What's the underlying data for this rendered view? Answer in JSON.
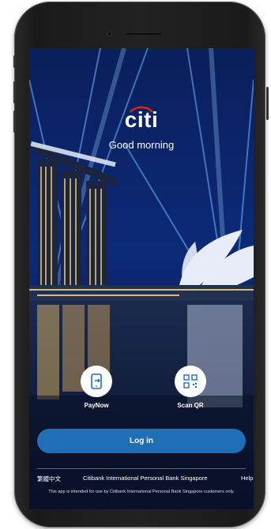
{
  "app": {
    "brand": "citi",
    "greeting": "Good morning"
  },
  "quick_actions": [
    {
      "label": "PayNow",
      "icon": "paynow-icon"
    },
    {
      "label": "Scan QR",
      "icon": "qr-code-icon"
    }
  ],
  "login": {
    "label": "Log in"
  },
  "footer": {
    "language": "繁體中文",
    "bank_name": "Citibank International Personal Bank Singapore",
    "help": "Help",
    "disclaimer": "This app is intended for use by Citibank International Personal Bank Singapore customers only."
  },
  "colors": {
    "accent_blue": "#1f6fb6",
    "logo_arc_red": "#e2231a",
    "background_navy": "#081a4a"
  }
}
